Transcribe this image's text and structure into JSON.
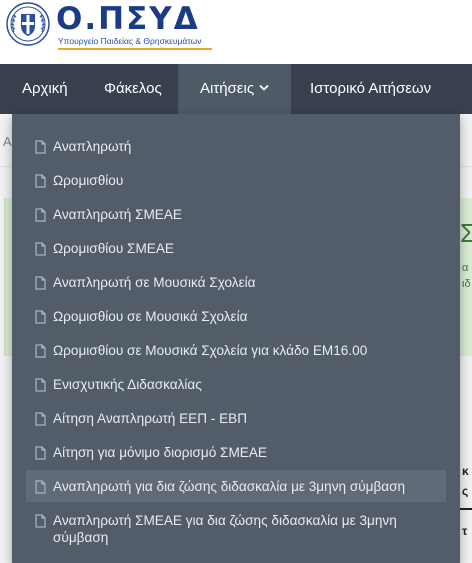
{
  "brand": {
    "title": "Ο.ΠΣΥΔ",
    "subtitle": "Υπουργείο Παιδείας & Θρησκευμάτων"
  },
  "nav": {
    "items": [
      {
        "label": "Αρχική"
      },
      {
        "label": "Φάκελος"
      },
      {
        "label": "Αιτήσεις"
      },
      {
        "label": "Ιστορικό Αιτήσεων"
      }
    ],
    "active_index": 2
  },
  "dropdown": {
    "items": [
      {
        "label": "Αναπληρωτή"
      },
      {
        "label": "Ωρομισθίου"
      },
      {
        "label": "Αναπληρωτή ΣΜΕΑΕ"
      },
      {
        "label": "Ωρομισθίου ΣΜΕΑΕ"
      },
      {
        "label": "Αναπληρωτή σε Μουσικά Σχολεία"
      },
      {
        "label": "Ωρομισθίου σε Μουσικά Σχολεία"
      },
      {
        "label": "Ωρομισθίου σε Μουσικά Σχολεία για κλάδο ΕΜ16.00"
      },
      {
        "label": "Ενισχυτικής Διδασκαλίας"
      },
      {
        "label": "Αίτηση Αναπληρωτή ΕΕΠ - ΕΒΠ"
      },
      {
        "label": "Αίτηση για μόνιμο διορισμό ΣΜΕΑΕ"
      },
      {
        "label": "Αναπληρωτή για δια ζώσης διδασκαλία με 3μηνη σύμβαση"
      },
      {
        "label": "Αναπληρωτή ΣΜΕΑΕ για δια ζώσης διδασκαλία με 3μηνη σύμβαση"
      }
    ],
    "hovered_index": 10
  },
  "background": {
    "breadcrumb_fragment": "Α",
    "panel_heading_fragment": "Σ",
    "panel_line1_fragment": "α",
    "panel_line2_fragment": "ιδ",
    "text_fragment1": "κ",
    "text_fragment2": "ς",
    "text_fragment3": "τ"
  },
  "colors": {
    "navbar": "#38414d",
    "nav_active": "#4f5a67",
    "dropdown": "#525d69",
    "dropdown_hover": "#606b77",
    "brand": "#1b3b87",
    "brand_accent": "#e9a82b",
    "success_panel": "#d9ecd3"
  },
  "icons": {
    "logo": "greek-seal-icon",
    "caret": "chevron-down-icon",
    "item": "document-icon"
  }
}
